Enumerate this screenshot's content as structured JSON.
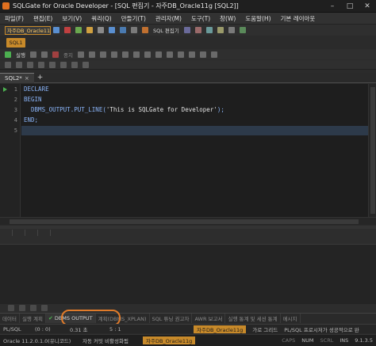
{
  "window": {
    "title": "SQLGate for Oracle Developer - [SQL 편집기 - 자주DB_Oracle11g [SQL2]]",
    "minimize": "–",
    "maximize": "□",
    "close": "✕"
  },
  "menu": [
    "파일(F)",
    "편집(E)",
    "보기(V)",
    "쿼리(Q)",
    "만들기(T)",
    "관리자(M)",
    "도구(T)",
    "창(W)",
    "도움말(H)",
    "기본 레이아웃"
  ],
  "toolbar": {
    "connection": "자주DB_Oracle11g",
    "sql_editor": "SQL 편집기"
  },
  "conn_tab": "SQL1",
  "toolbar2": {
    "run": "실행",
    "stop": "중지"
  },
  "editor": {
    "tab_label": "SQL2*",
    "tab_close": "×",
    "tab_add": "+",
    "line_numbers": [
      "1",
      "2",
      "3",
      "4",
      "5"
    ],
    "lines": {
      "l1": "DECLARE",
      "l2": "BEGIN",
      "l3_code": "  DBMS_OUTPUT.PUT_LINE(",
      "l3_str": "'This is SQLGate for Developer'",
      "l3_end": ");",
      "l4": "END;",
      "l5": ""
    }
  },
  "bottom_tabs": {
    "data": "데이터",
    "run_plan": "실행 계획",
    "dbms_output": "DBMS OUTPUT",
    "plan": "계획(DBMS_XPLAN)",
    "sql_tuning": "SQL 튜닝 권고자",
    "awr": "AWR 보고서",
    "session_stats": "실행 통계 및 세션 통계",
    "message": "메시지"
  },
  "status1": {
    "lang": "PL/SQL",
    "pos": "(0 : 0)",
    "time": "0.31 초",
    "cursor": "5 : 1",
    "connection": "자주DB_Oracle11g",
    "grid": "가로 그리드",
    "message": "PL/SQL 프로시저가 성공적으로 완"
  },
  "status2": {
    "version": "Oracle 11.2.0.1.0(유니코드)",
    "autocommit": "자동 커밋 비활성화됨",
    "connection": "자주DB_Oracle11g",
    "caps": "CAPS",
    "num": "NUM",
    "scrl": "SCRL",
    "ins": "INS",
    "build": "9.1.3.5"
  }
}
